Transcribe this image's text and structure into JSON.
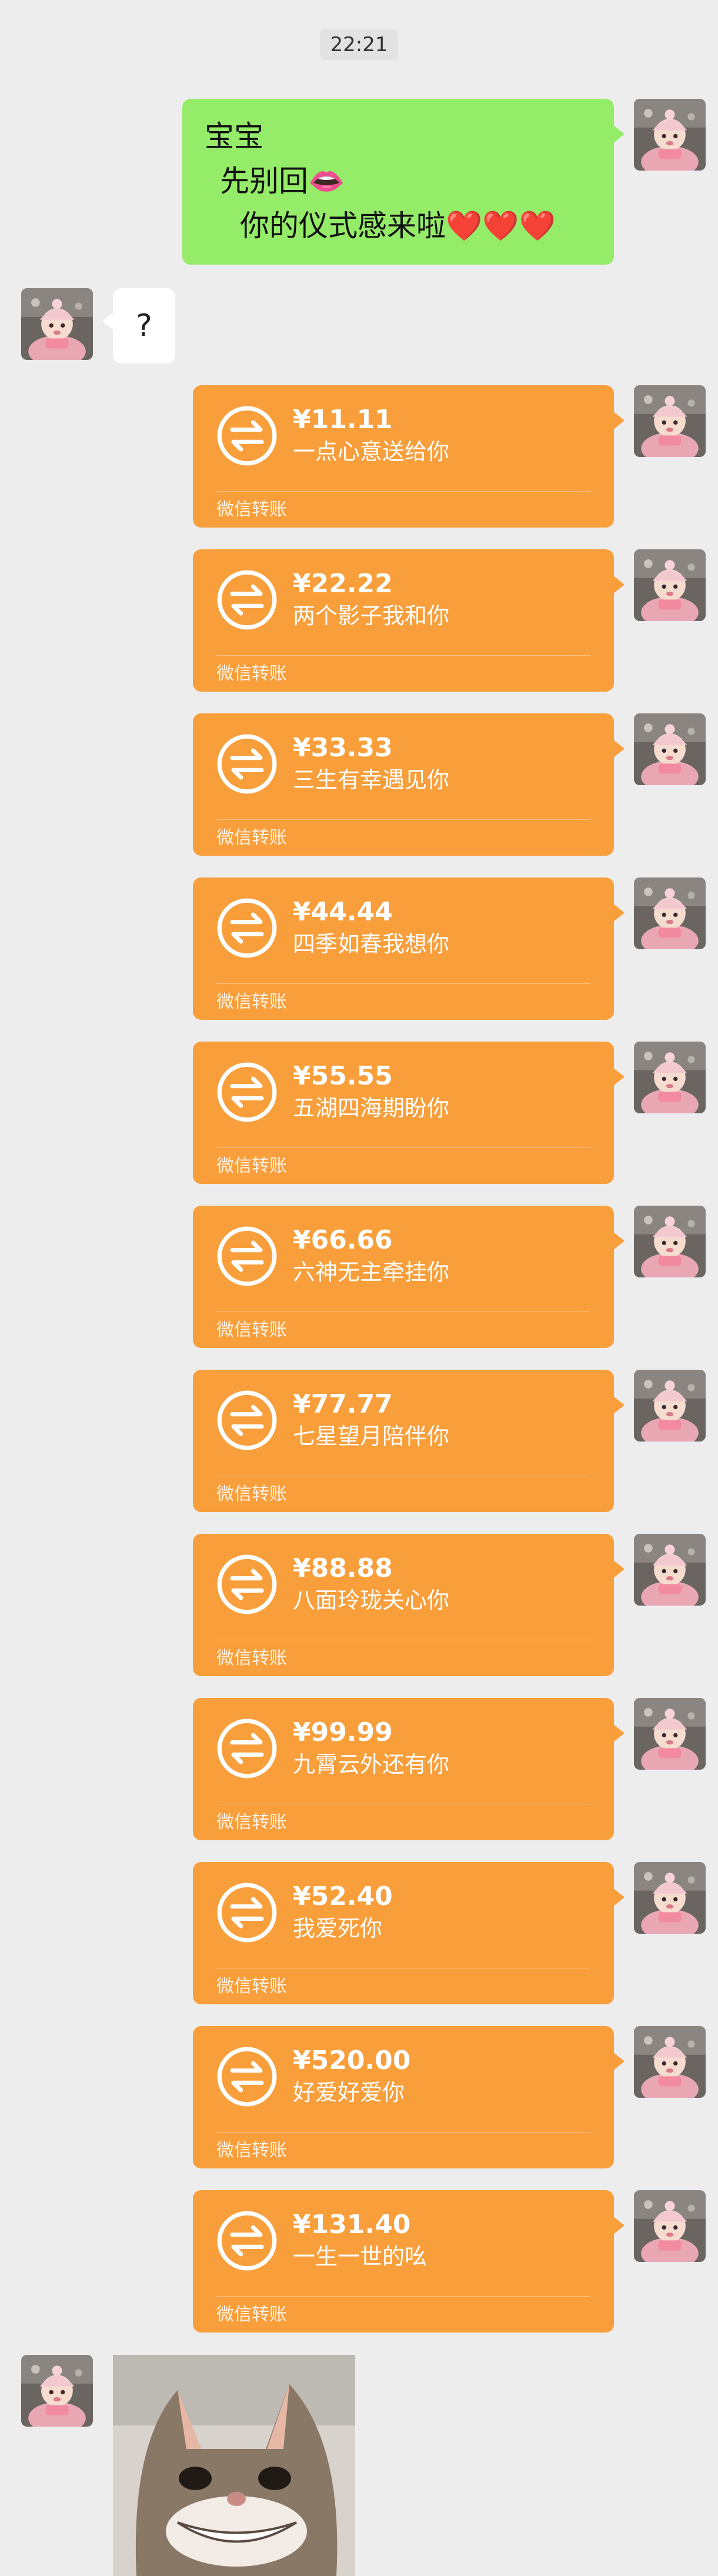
{
  "chat": {
    "timestamp": "22:21",
    "sent_text": {
      "line1": "宝宝",
      "line2": "先别回👄",
      "line3": "你的仪式感来啦",
      "hearts": "❤️❤️❤️"
    },
    "received_text": "?",
    "transfer_label": "微信转账",
    "transfers": [
      {
        "amount": "¥11.11",
        "note": "一点心意送给你"
      },
      {
        "amount": "¥22.22",
        "note": "两个影子我和你"
      },
      {
        "amount": "¥33.33",
        "note": "三生有幸遇见你"
      },
      {
        "amount": "¥44.44",
        "note": "四季如春我想你"
      },
      {
        "amount": "¥55.55",
        "note": "五湖四海期盼你"
      },
      {
        "amount": "¥66.66",
        "note": "六神无主牵挂你"
      },
      {
        "amount": "¥77.77",
        "note": "七星望月陪伴你"
      },
      {
        "amount": "¥88.88",
        "note": "八面玲珑关心你"
      },
      {
        "amount": "¥99.99",
        "note": "九霄云外还有你"
      },
      {
        "amount": "¥52.40",
        "note": "我爱死你"
      },
      {
        "amount": "¥520.00",
        "note": "好爱好爱你"
      },
      {
        "amount": "¥131.40",
        "note": "一生一世的吆"
      }
    ],
    "colors": {
      "background": "#ededed",
      "sent_bubble": "#95ec69",
      "transfer_card": "#f89e3b",
      "received_bubble": "#ffffff"
    },
    "icons": {
      "transfer_icon": "transfer-arrows-icon",
      "avatar": "avatar-girl-pink-hat",
      "sticker": "smiling-cat-sticker"
    }
  }
}
